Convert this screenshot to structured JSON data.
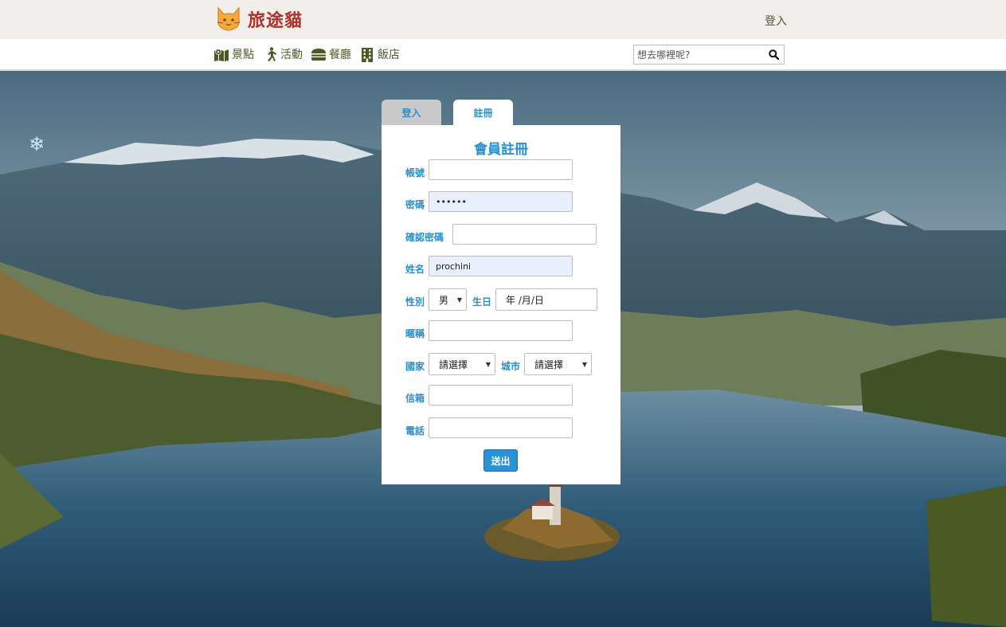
{
  "brand": {
    "name": "旅途貓"
  },
  "header": {
    "login_link": "登入"
  },
  "nav": {
    "items": [
      {
        "label": "景點",
        "icon": "map-location-icon"
      },
      {
        "label": "活動",
        "icon": "running-person-icon"
      },
      {
        "label": "餐廳",
        "icon": "burger-icon"
      },
      {
        "label": "飯店",
        "icon": "hotel-building-icon"
      }
    ]
  },
  "search": {
    "placeholder": "想去哪裡呢?",
    "value": ""
  },
  "tabs": {
    "login": "登入",
    "register": "註冊",
    "active": "register"
  },
  "form": {
    "title": "會員註冊",
    "account": {
      "label": "帳號",
      "value": ""
    },
    "password": {
      "label": "密碼",
      "value": "••••••"
    },
    "confirm_password": {
      "label": "確認密碼",
      "value": ""
    },
    "name": {
      "label": "姓名",
      "value": "prochini"
    },
    "gender": {
      "label": "性別",
      "value": "男"
    },
    "birthday": {
      "label": "生日",
      "value": "年 /月/日"
    },
    "nickname": {
      "label": "暱稱",
      "value": ""
    },
    "country": {
      "label": "國家",
      "value": "請選擇"
    },
    "city": {
      "label": "城市",
      "value": "請選擇"
    },
    "email": {
      "label": "信箱",
      "value": ""
    },
    "phone": {
      "label": "電話",
      "value": ""
    },
    "submit": "送出"
  },
  "colors": {
    "brand_red": "#b0302a",
    "accent_blue": "#2a8fcf",
    "nav_green": "#4a5a26",
    "header_bg": "#f1eeeb",
    "autofill_bg": "#e8f0fe"
  }
}
